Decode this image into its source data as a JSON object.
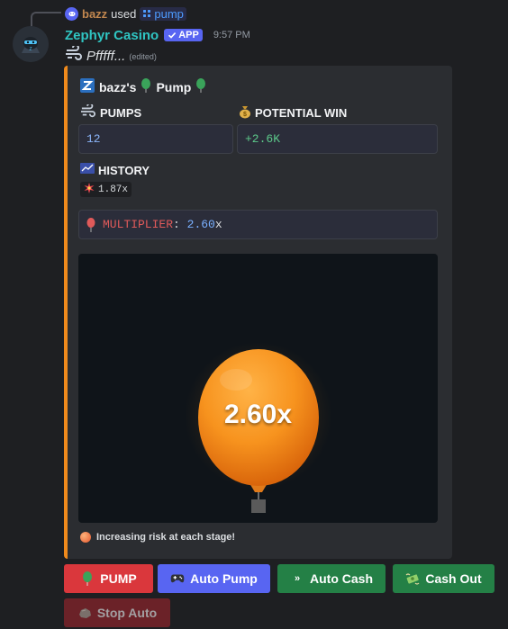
{
  "reply": {
    "user": "bazz",
    "used_text": "used",
    "command": "pump"
  },
  "message": {
    "bot_name": "Zephyr Casino",
    "app_badge": "APP",
    "timestamp": "9:57 PM",
    "text": "Pfffff...",
    "edited": "(edited)"
  },
  "embed": {
    "accent_color": "#f08a1c",
    "title_user": "bazz's",
    "title_game": "Pump",
    "fields": {
      "pumps_label": "PUMPS",
      "pumps_value": "12",
      "win_label": "POTENTIAL WIN",
      "win_value": "+2.6K",
      "history_label": "HISTORY",
      "history_value": "1.87x",
      "multiplier_label": "MULTIPLIER",
      "multiplier_colon": ":",
      "multiplier_value": "2.60",
      "multiplier_suffix": "x"
    },
    "balloon_text": "2.60x",
    "footer": "Increasing risk at each stage!"
  },
  "buttons": {
    "pump": "PUMP",
    "auto_pump": "Auto Pump",
    "auto_cash": "Auto Cash",
    "cash_out": "Cash Out",
    "stop_auto": "Stop Auto"
  },
  "colors": {
    "bot_name": "#2fc5c2",
    "red_button": "#da373c",
    "blurple_button": "#5865f2",
    "green_button": "#248046",
    "disabled_button": "#6b2228"
  }
}
